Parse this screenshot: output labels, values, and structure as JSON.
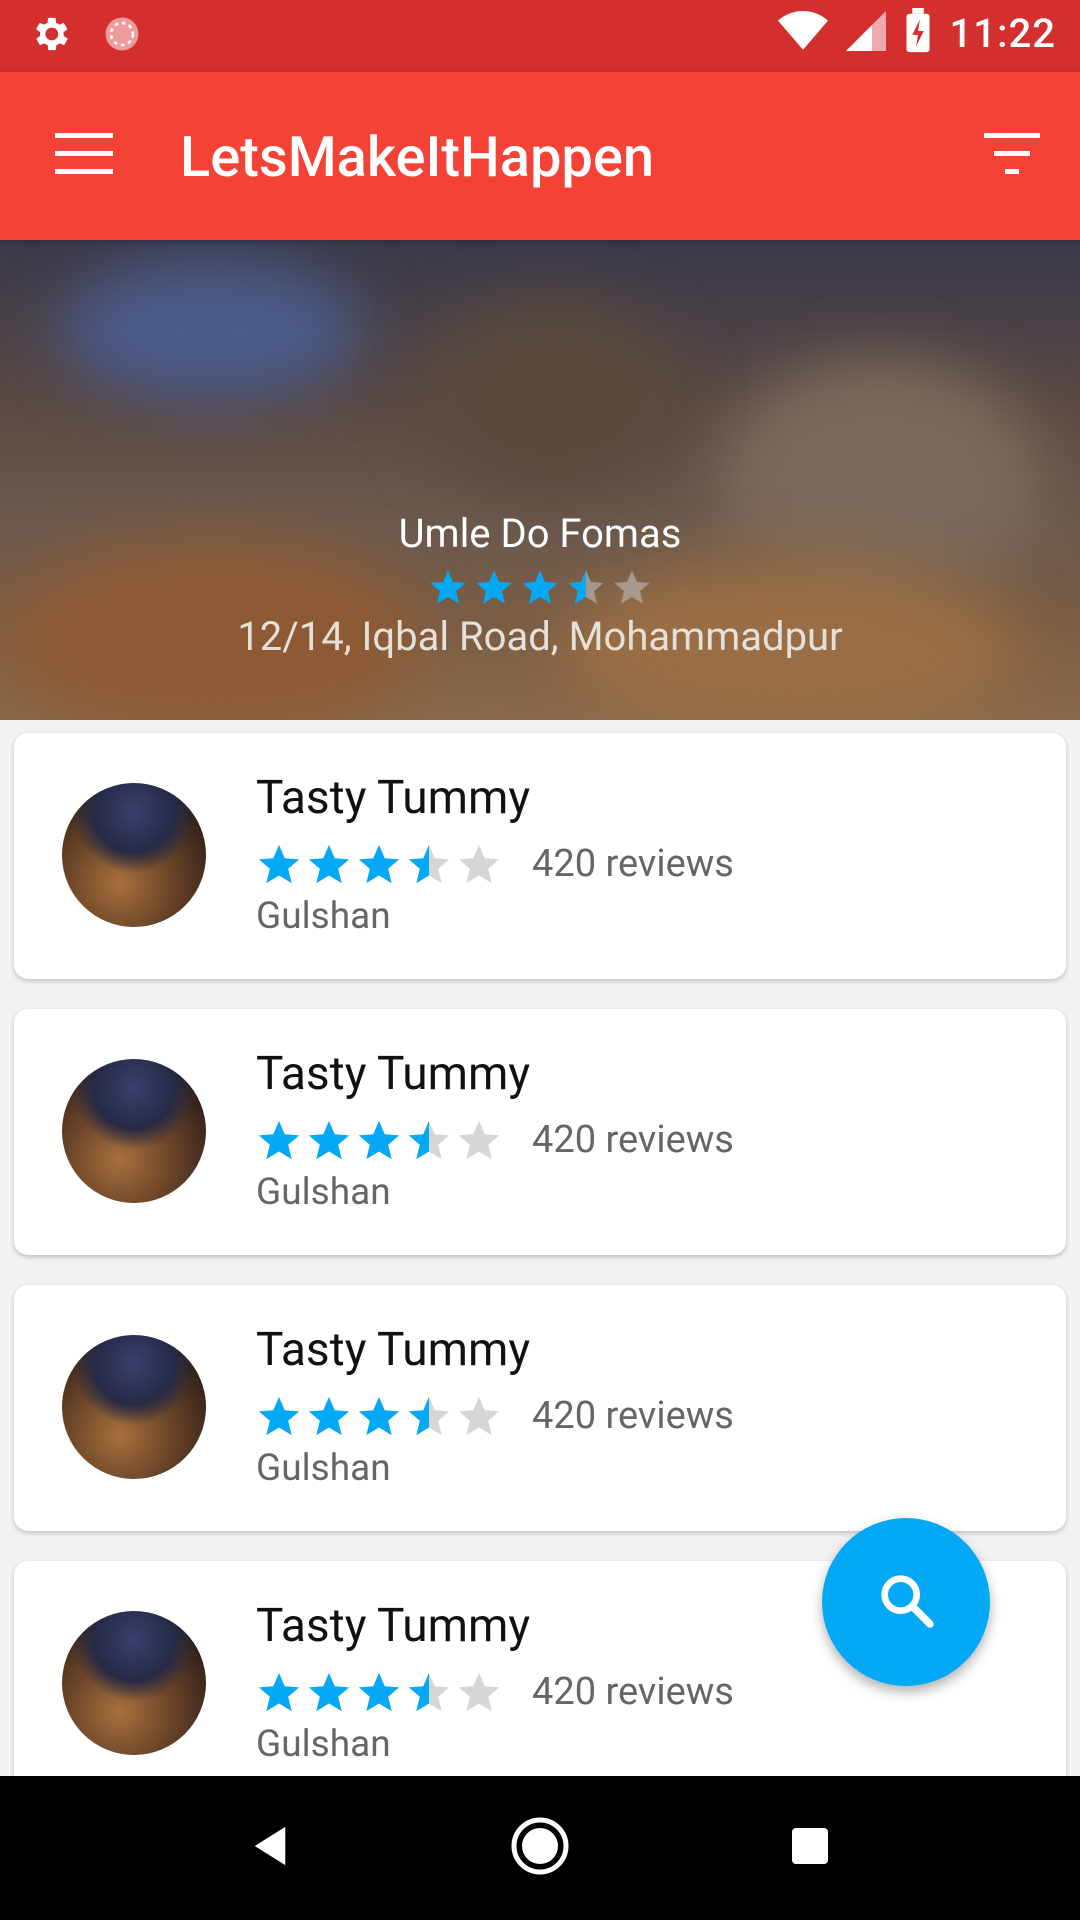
{
  "status_bar": {
    "time": "11:22",
    "icons": [
      "settings-icon",
      "sync-icon",
      "wifi-icon",
      "signal-icon",
      "battery-charging-icon"
    ]
  },
  "app_bar": {
    "title": "LetsMakeItHappen",
    "menu_icon": "menu-icon",
    "filter_icon": "filter-icon"
  },
  "featured": {
    "name": "Umle Do Fomas",
    "rating": 3.5,
    "max_rating": 5,
    "address": "12/14, Iqbal Road, Mohammadpur"
  },
  "restaurants": [
    {
      "name": "Tasty Tummy",
      "rating": 3.5,
      "reviews": "420 reviews",
      "area": "Gulshan"
    },
    {
      "name": "Tasty Tummy",
      "rating": 3.5,
      "reviews": "420 reviews",
      "area": "Gulshan"
    },
    {
      "name": "Tasty Tummy",
      "rating": 3.5,
      "reviews": "420 reviews",
      "area": "Gulshan"
    },
    {
      "name": "Tasty Tummy",
      "rating": 3.5,
      "reviews": "420 reviews",
      "area": "Gulshan"
    }
  ],
  "fab": {
    "icon": "search-icon"
  },
  "nav_bar": {
    "icons": [
      "back-icon",
      "home-icon",
      "recents-icon"
    ]
  },
  "colors": {
    "status_bar": "#d32f2f",
    "app_bar": "#f44336",
    "star_filled": "#03a9f4",
    "star_empty": "#d6d6d6",
    "fab": "#03a9f4"
  }
}
